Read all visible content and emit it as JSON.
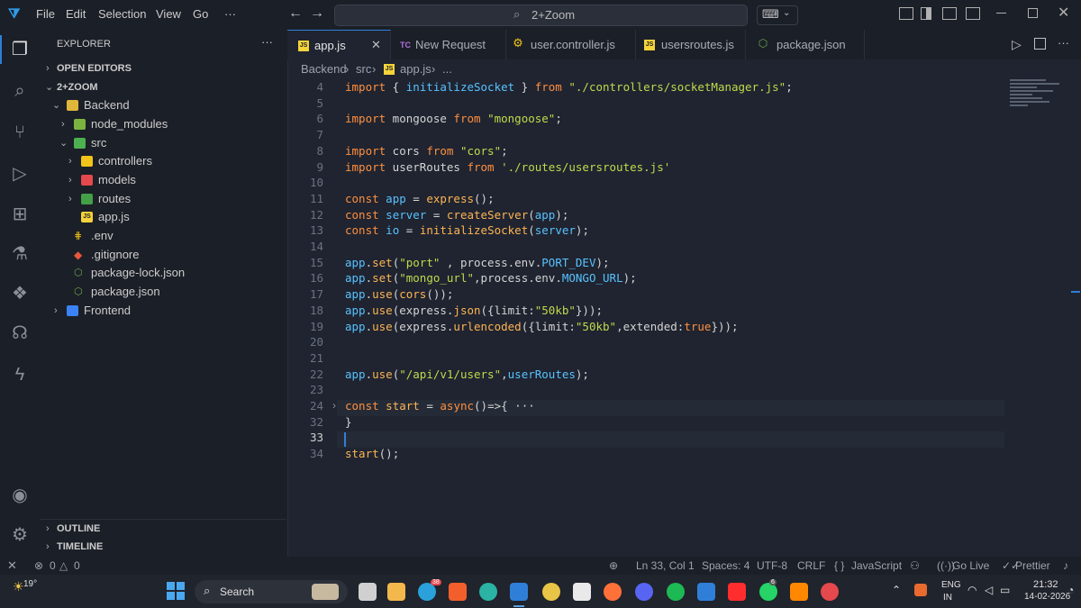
{
  "titlebar": {
    "menu": [
      "File",
      "Edit",
      "Selection",
      "View",
      "Go",
      "···"
    ],
    "command_center": "2+Zoom"
  },
  "sidebar": {
    "title": "EXPLORER",
    "more": "···",
    "open_editors": "OPEN EDITORS",
    "workspace": "2+ZOOM",
    "items": [
      {
        "label": "Backend"
      },
      {
        "label": "node_modules"
      },
      {
        "label": "src"
      },
      {
        "label": "controllers"
      },
      {
        "label": "models"
      },
      {
        "label": "routes"
      },
      {
        "label": "app.js"
      },
      {
        "label": ".env"
      },
      {
        "label": ".gitignore"
      },
      {
        "label": "package-lock.json"
      },
      {
        "label": "package.json"
      },
      {
        "label": "Frontend"
      }
    ],
    "outline": "OUTLINE",
    "timeline": "TIMELINE"
  },
  "tabs": [
    {
      "label": "app.js",
      "icon": "JS"
    },
    {
      "label": "New Request",
      "icon": "TC"
    },
    {
      "label": "user.controller.js",
      "icon": "gear"
    },
    {
      "label": "usersroutes.js",
      "icon": "JS"
    },
    {
      "label": "package.json",
      "icon": "node"
    }
  ],
  "breadcrumb": [
    "Backend",
    "src",
    "app.js",
    "..."
  ],
  "editor": {
    "lines": [
      {
        "n": "4",
        "tokens": [
          [
            "kw",
            "import"
          ],
          [
            "pl",
            " { "
          ],
          [
            "var",
            "initializeSocket"
          ],
          [
            "pl",
            " } "
          ],
          [
            "kw",
            "from"
          ],
          [
            "pl",
            " "
          ],
          [
            "str",
            "\"./controllers/socketManager.js\""
          ],
          [
            "pl",
            ";"
          ]
        ]
      },
      {
        "n": "5",
        "tokens": []
      },
      {
        "n": "6",
        "tokens": [
          [
            "kw",
            "import"
          ],
          [
            "pl",
            " mongoose "
          ],
          [
            "kw",
            "from"
          ],
          [
            "pl",
            " "
          ],
          [
            "str",
            "\"mongoose\""
          ],
          [
            "pl",
            ";"
          ]
        ]
      },
      {
        "n": "7",
        "tokens": []
      },
      {
        "n": "8",
        "tokens": [
          [
            "kw",
            "import"
          ],
          [
            "pl",
            " cors "
          ],
          [
            "kw",
            "from"
          ],
          [
            "pl",
            " "
          ],
          [
            "str",
            "\"cors\""
          ],
          [
            "pl",
            ";"
          ]
        ]
      },
      {
        "n": "9",
        "tokens": [
          [
            "kw",
            "import"
          ],
          [
            "pl",
            " userRoutes "
          ],
          [
            "kw",
            "from"
          ],
          [
            "pl",
            " "
          ],
          [
            "str",
            "'./routes/usersroutes.js'"
          ]
        ]
      },
      {
        "n": "10",
        "tokens": []
      },
      {
        "n": "11",
        "tokens": [
          [
            "kw",
            "const"
          ],
          [
            "pl",
            " "
          ],
          [
            "var",
            "app"
          ],
          [
            "pl",
            " = "
          ],
          [
            "fn",
            "express"
          ],
          [
            "pl",
            "();"
          ]
        ]
      },
      {
        "n": "12",
        "tokens": [
          [
            "kw",
            "const"
          ],
          [
            "pl",
            " "
          ],
          [
            "var",
            "server"
          ],
          [
            "pl",
            " = "
          ],
          [
            "fn",
            "createServer"
          ],
          [
            "pl",
            "("
          ],
          [
            "var",
            "app"
          ],
          [
            "pl",
            ");"
          ]
        ]
      },
      {
        "n": "13",
        "tokens": [
          [
            "kw",
            "const"
          ],
          [
            "pl",
            " "
          ],
          [
            "var",
            "io"
          ],
          [
            "pl",
            " = "
          ],
          [
            "fn",
            "initializeSocket"
          ],
          [
            "pl",
            "("
          ],
          [
            "var",
            "server"
          ],
          [
            "pl",
            ");"
          ]
        ]
      },
      {
        "n": "14",
        "tokens": []
      },
      {
        "n": "15",
        "tokens": [
          [
            "var",
            "app"
          ],
          [
            "pl",
            "."
          ],
          [
            "fn",
            "set"
          ],
          [
            "pl",
            "("
          ],
          [
            "str",
            "\"port\""
          ],
          [
            "pl",
            " , process.env."
          ],
          [
            "prop",
            "PORT_DEV"
          ],
          [
            "pl",
            ");"
          ]
        ]
      },
      {
        "n": "16",
        "tokens": [
          [
            "var",
            "app"
          ],
          [
            "pl",
            "."
          ],
          [
            "fn",
            "set"
          ],
          [
            "pl",
            "("
          ],
          [
            "str",
            "\"mongo_url\""
          ],
          [
            "pl",
            ",process.env."
          ],
          [
            "prop",
            "MONGO_URL"
          ],
          [
            "pl",
            ");"
          ]
        ]
      },
      {
        "n": "17",
        "tokens": [
          [
            "var",
            "app"
          ],
          [
            "pl",
            "."
          ],
          [
            "fn",
            "use"
          ],
          [
            "pl",
            "("
          ],
          [
            "fn",
            "cors"
          ],
          [
            "pl",
            "());"
          ]
        ]
      },
      {
        "n": "18",
        "tokens": [
          [
            "var",
            "app"
          ],
          [
            "pl",
            "."
          ],
          [
            "fn",
            "use"
          ],
          [
            "pl",
            "(express."
          ],
          [
            "fn",
            "json"
          ],
          [
            "pl",
            "({limit:"
          ],
          [
            "str",
            "\"50kb\""
          ],
          [
            "pl",
            "}));"
          ]
        ]
      },
      {
        "n": "19",
        "tokens": [
          [
            "var",
            "app"
          ],
          [
            "pl",
            "."
          ],
          [
            "fn",
            "use"
          ],
          [
            "pl",
            "(express."
          ],
          [
            "fn",
            "urlencoded"
          ],
          [
            "pl",
            "({limit:"
          ],
          [
            "str",
            "\"50kb\""
          ],
          [
            "pl",
            ",extended:"
          ],
          [
            "kw",
            "true"
          ],
          [
            "pl",
            "}));"
          ]
        ]
      },
      {
        "n": "20",
        "tokens": []
      },
      {
        "n": "21",
        "tokens": []
      },
      {
        "n": "22",
        "tokens": [
          [
            "var",
            "app"
          ],
          [
            "pl",
            "."
          ],
          [
            "fn",
            "use"
          ],
          [
            "pl",
            "("
          ],
          [
            "str",
            "\"/api/v1/users\""
          ],
          [
            "pl",
            ","
          ],
          [
            "var",
            "userRoutes"
          ],
          [
            "pl",
            ");"
          ]
        ]
      },
      {
        "n": "23",
        "tokens": []
      },
      {
        "n": "24",
        "tokens": [
          [
            "kw",
            "const"
          ],
          [
            "pl",
            " "
          ],
          [
            "fn",
            "start"
          ],
          [
            "pl",
            " = "
          ],
          [
            "kw",
            "async"
          ],
          [
            "pl",
            "()=>{ ···"
          ]
        ]
      },
      {
        "n": "32",
        "tokens": [
          [
            "pl",
            "}"
          ]
        ]
      },
      {
        "n": "33",
        "tokens": []
      },
      {
        "n": "34",
        "tokens": [
          [
            "fn",
            "start"
          ],
          [
            "pl",
            "();"
          ]
        ]
      }
    ]
  },
  "status": {
    "errors": "0",
    "warnings": "0",
    "position": "Ln 33, Col 1",
    "spaces": "Spaces: 4",
    "encoding": "UTF-8",
    "eol": "CRLF",
    "language": "JavaScript",
    "golive": "Go Live",
    "prettier": "Prettier"
  },
  "taskbar": {
    "weather": "19°",
    "search": "Search",
    "lang1": "ENG",
    "lang2": "IN",
    "time": "21:32",
    "date": "14-02-2026",
    "telegram_badge": "38",
    "whatsapp_badge": "6"
  },
  "colors": {
    "accent": "#2f7fd8",
    "keyword": "#ff8f40",
    "string": "#c2d94c",
    "function": "#ffb454",
    "variable": "#59c2ff"
  }
}
